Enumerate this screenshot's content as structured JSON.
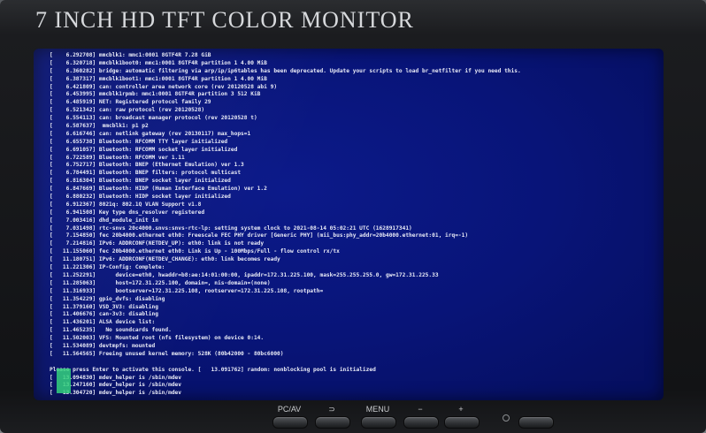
{
  "monitor": {
    "label": "7 INCH HD TFT COLOR MONITOR",
    "buttons": [
      "PC/AV",
      "⊃",
      "MENU",
      "−",
      "+"
    ]
  },
  "console_lines": [
    "[    6.292708] mmcblk1: mmc1:0001 8GTF4R 7.28 GiB",
    "[    6.320718] mmcblk1boot0: mmc1:0001 8GTF4R partition 1 4.00 MiB",
    "[    6.360282] bridge: automatic filtering via arp/ip/ip6tables has been deprecated. Update your scripts to load br_netfilter if you need this.",
    "[    6.387317] mmcblk1boot1: mmc1:0001 8GTF4R partition 1 4.00 MiB",
    "[    6.421809] can: controller area network core (rev 20120528 abi 9)",
    "[    6.453995] mmcblk1rpmb: mmc1:0001 8GTF4R partition 3 512 KiB",
    "[    6.485919] NET: Registered protocol family 29",
    "[    6.521342] can: raw protocol (rev 20120528)",
    "[    6.554113] can: broadcast manager protocol (rev 20120528 t)",
    "[    6.587637]  mmcblk1: p1 p2",
    "[    6.616746] can: netlink gateway (rev 20130117) max_hops=1",
    "[    6.655738] Bluetooth: RFCOMM TTY layer initialized",
    "[    6.691057] Bluetooth: RFCOMM socket layer initialized",
    "[    6.722589] Bluetooth: RFCOMM ver 1.11",
    "[    6.752717] Bluetooth: BNEP (Ethernet Emulation) ver 1.3",
    "[    6.784491] Bluetooth: BNEP filters: protocol multicast",
    "[    6.816304] Bluetooth: BNEP socket layer initialized",
    "[    6.847669] Bluetooth: HIDP (Human Interface Emulation) ver 1.2",
    "[    6.880232] Bluetooth: HIDP socket layer initialized",
    "[    6.912367] 8021q: 802.1Q VLAN Support v1.8",
    "[    6.941508] Key type dns_resolver registered",
    "[    7.003416] dhd_module_init in",
    "[    7.031498] rtc-snvs 20c4000.snvs:snvs-rtc-lp: setting system clock to 2021-08-14 05:02:21 UTC (1628917341)",
    "[    7.154850] fec 20b4000.ethernet eth0: Freescale FEC PHY driver [Generic PHY] (mii_bus:phy_addr=20b4000.ethernet:01, irq=-1)",
    "[    7.214816] IPv6: ADDRCONF(NETDEV_UP): eth0: link is not ready",
    "[   11.155060] fec 20b4000.ethernet eth0: Link is Up - 100Mbps/Full - flow control rx/tx",
    "[   11.180751] IPv6: ADDRCONF(NETDEV_CHANGE): eth0: link becomes ready",
    "[   11.221306] IP-Config: Complete:",
    "[   11.252291]      device=eth0, hwaddr=b8:ae:14:01:00:00, ipaddr=172.31.225.100, mask=255.255.255.0, gw=172.31.225.33",
    "[   11.285063]      host=172.31.225.100, domain=, nis-domain=(none)",
    "[   11.316933]      bootserver=172.31.225.108, rootserver=172.31.225.108, rootpath=",
    "[   11.354229] gpio_dvfs: disabling",
    "[   11.379160] VSD_3V3: disabling",
    "[   11.406676] can-3v3: disabling",
    "[   11.436201] ALSA device list:",
    "[   11.465235]   No soundcards found.",
    "[   11.502003] VFS: Mounted root (nfs filesystem) on device 0:14.",
    "[   11.534089] devtmpfs: mounted",
    "[   11.564565] Freeing unused kernel memory: 528K (80b42000 - 80bc6000)",
    "",
    "Please press Enter to activate this console. [   13.091762] random: nonblocking pool is initialized",
    "[   13.094830] mdev_helper is /sbin/mdev",
    "[   13.247160] mdev_helper is /sbin/mdev",
    "[   13.304720] mdev_helper is /sbin/mdev"
  ]
}
